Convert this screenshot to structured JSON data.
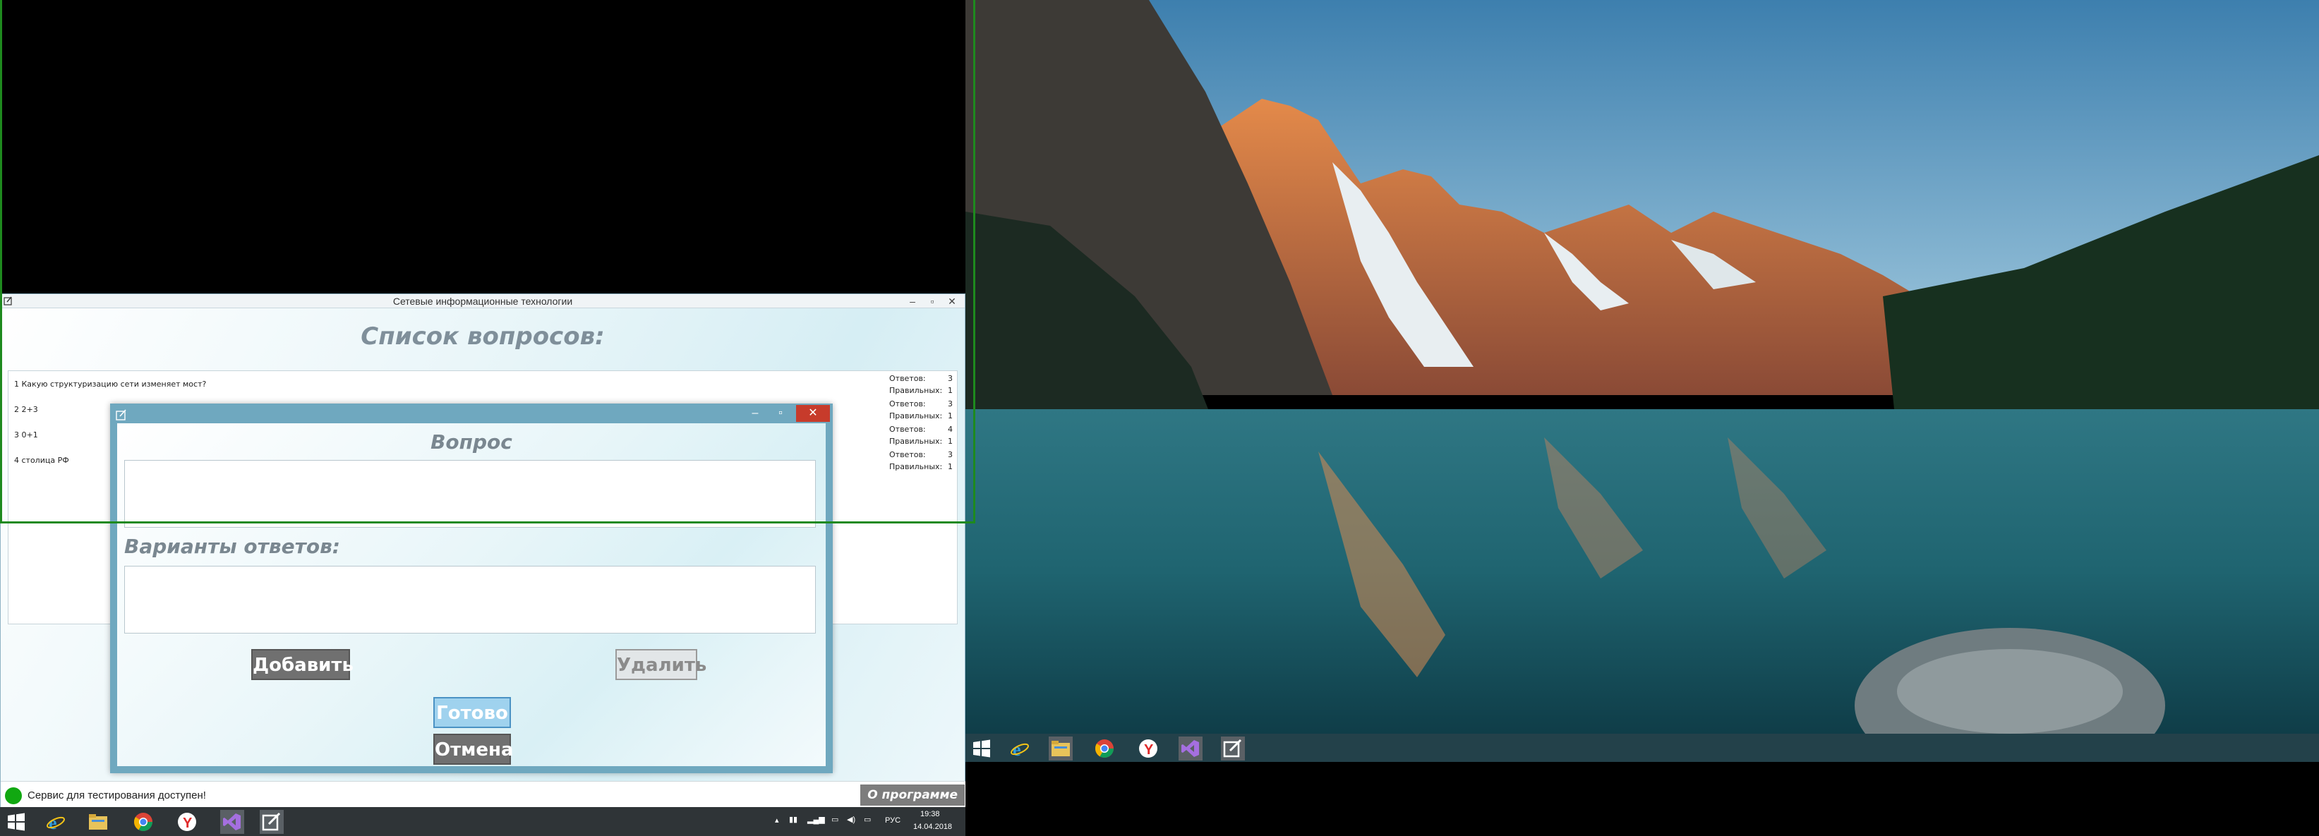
{
  "main_window": {
    "title": "Сетевые информационные технологии",
    "heading": "Список вопросов:",
    "questions": [
      {
        "text": "1 Какую структуризацию сети изменяет мост?",
        "answers_label": "Ответов:",
        "answers": "3",
        "correct_label": "Правильных:",
        "correct": "1"
      },
      {
        "text": "2 2+3",
        "answers_label": "Ответов:",
        "answers": "3",
        "correct_label": "Правильных:",
        "correct": "1"
      },
      {
        "text": "3 0+1",
        "answers_label": "Ответов:",
        "answers": "4",
        "correct_label": "Правильных:",
        "correct": "1"
      },
      {
        "text": "4 столица РФ",
        "answers_label": "Ответов:",
        "answers": "3",
        "correct_label": "Правильных:",
        "correct": "1"
      }
    ],
    "status_text": "Сервис для тестирования доступен!",
    "status_color": "#11a811",
    "about_label": "О программе"
  },
  "dialog": {
    "question_heading": "Вопрос",
    "question_value": "",
    "answers_heading": "Варианты ответов:",
    "answers_value": "",
    "add_label": "Добавить",
    "delete_label": "Удалить",
    "done_label": "Готово",
    "cancel_label": "Отмена"
  },
  "left_taskbar": {
    "apps": [
      "windows-start-icon",
      "internet-explorer-icon",
      "file-explorer-icon",
      "chrome-icon",
      "yandex-browser-icon",
      "visual-studio-icon",
      "notepad-app-icon"
    ],
    "language": "РУС",
    "time": "19:38",
    "date": "14.04.2018"
  },
  "right_taskbar": {
    "apps": [
      "windows-start-icon",
      "internet-explorer-icon",
      "file-explorer-icon",
      "chrome-icon",
      "yandex-browser-icon",
      "visual-studio-icon",
      "notepad-app-icon"
    ]
  }
}
